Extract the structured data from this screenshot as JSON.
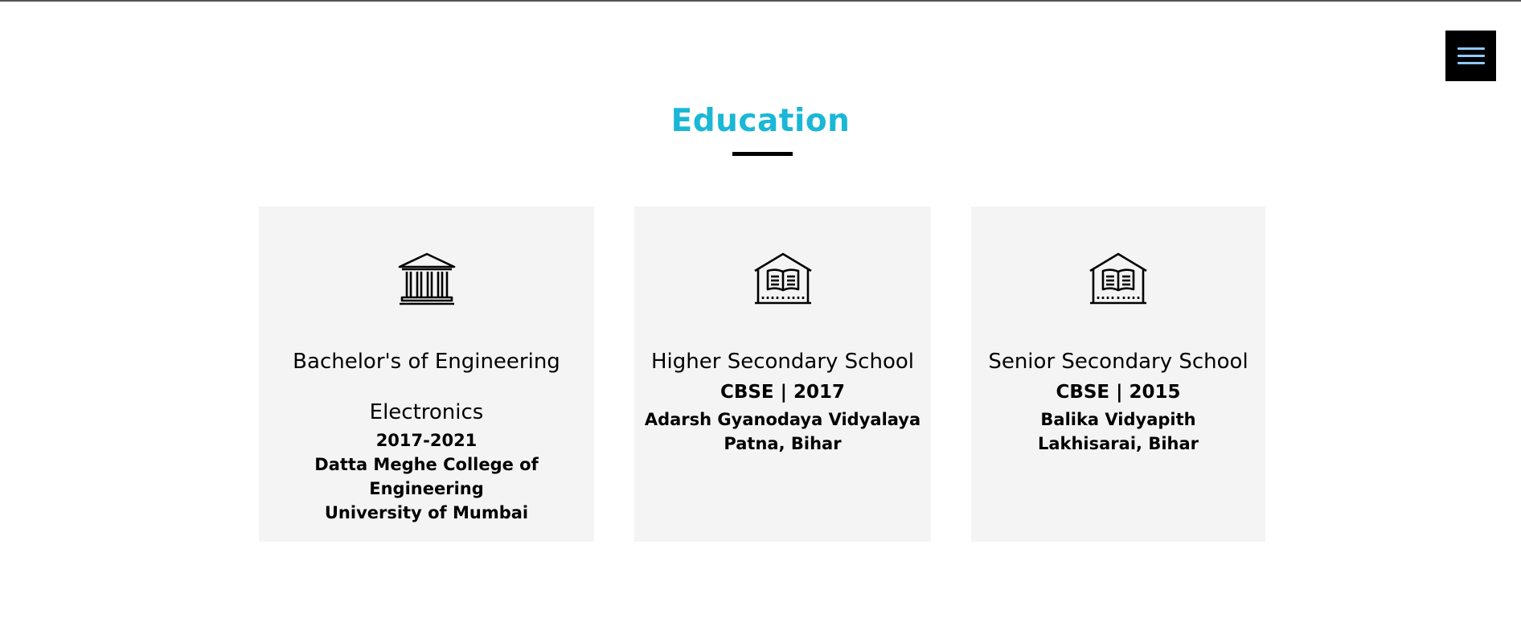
{
  "header": {
    "menu_icon": "hamburger-menu-icon",
    "menu_bar_color": "#8ec9ff"
  },
  "section": {
    "title": "Education",
    "title_color": "#1ab7d6"
  },
  "cards": [
    {
      "icon": "university-building-icon",
      "degree_line1": "Bachelor's of Engineering",
      "degree_line2": "Electronics",
      "years": "2017-2021",
      "institution": "Datta Meghe College of Engineering",
      "university": "University of Mumbai"
    },
    {
      "icon": "school-book-icon",
      "title": "Higher Secondary School",
      "board_year": "CBSE | 2017",
      "institution": "Adarsh Gyanodaya Vidyalaya",
      "location": "Patna, Bihar"
    },
    {
      "icon": "school-book-icon",
      "title": "Senior Secondary School",
      "board_year": "CBSE | 2015",
      "institution": "Balika Vidyapith",
      "location": "Lakhisarai, Bihar"
    }
  ]
}
